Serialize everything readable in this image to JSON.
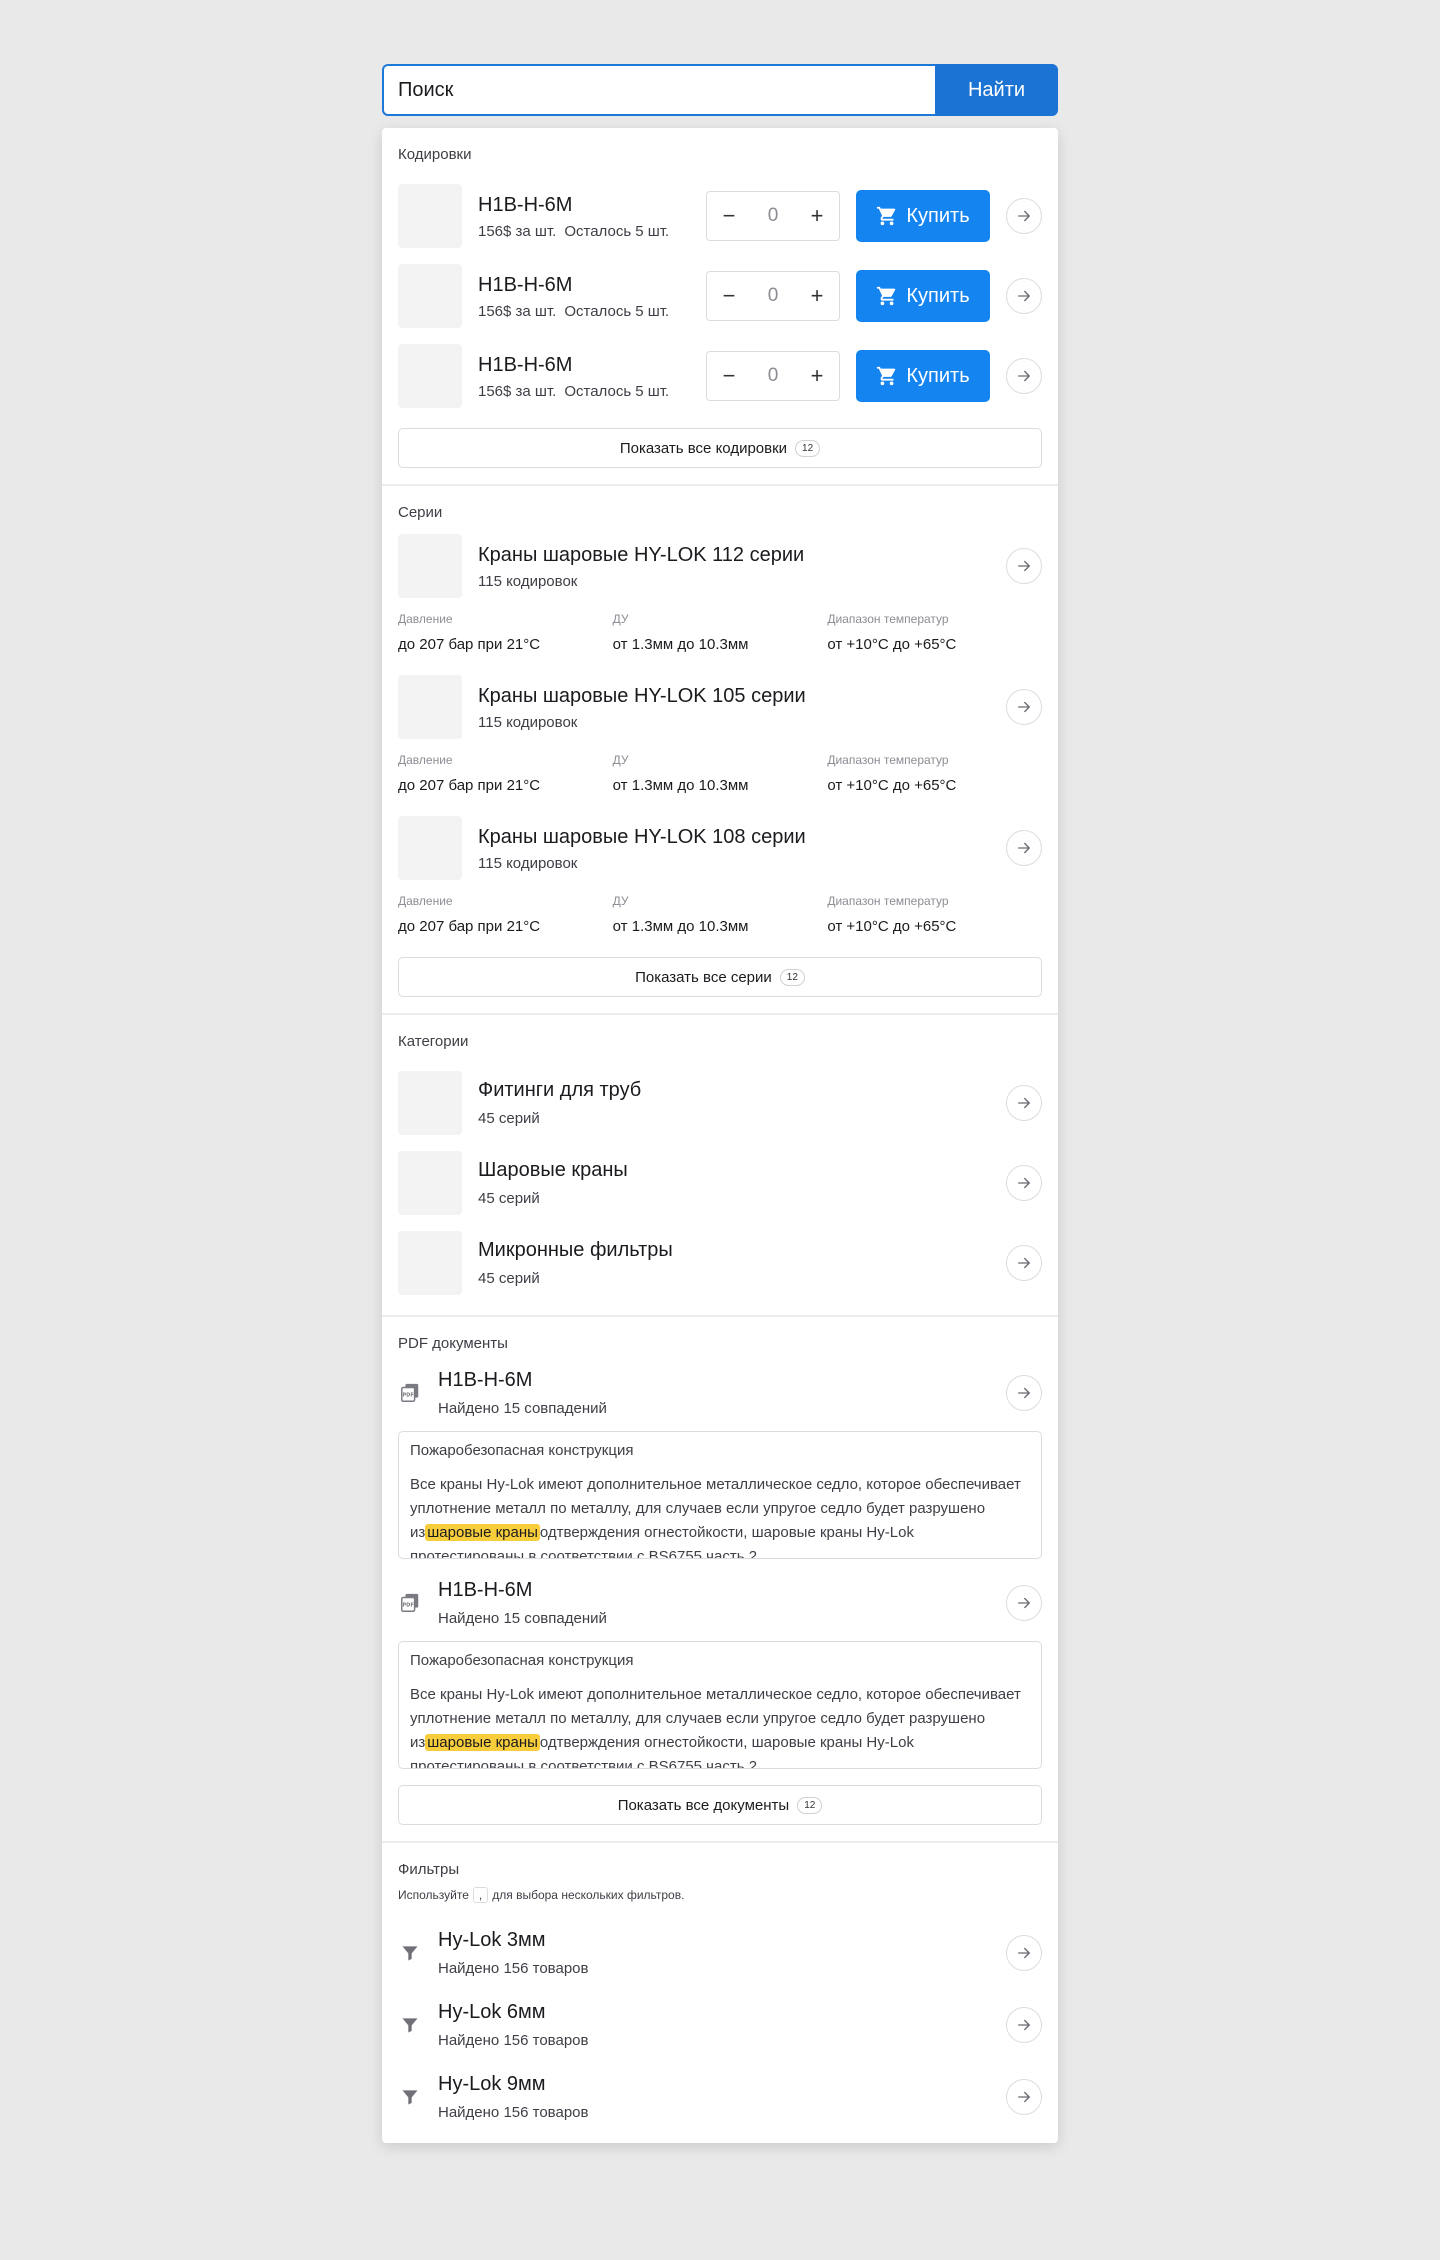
{
  "search": {
    "value": "Поиск",
    "button_label": "Найти"
  },
  "codings": {
    "title": "Кодировки",
    "items": [
      {
        "name": "H1B-H-6M",
        "price": "156$ за шт.",
        "stock": "Осталось 5 шт.",
        "qty": "0",
        "buy_label": "Купить"
      },
      {
        "name": "H1B-H-6M",
        "price": "156$ за шт.",
        "stock": "Осталось 5 шт.",
        "qty": "0",
        "buy_label": "Купить"
      },
      {
        "name": "H1B-H-6M",
        "price": "156$ за шт.",
        "stock": "Осталось 5 шт.",
        "qty": "0",
        "buy_label": "Купить"
      }
    ],
    "show_all_label": "Показать все кодировки",
    "show_all_count": "12"
  },
  "series": {
    "title": "Серии",
    "items": [
      {
        "name": "Краны шаровые HY-LOK 112 серии",
        "count": "115 кодировок",
        "specs": [
          {
            "label": "Давление",
            "value": "до 207 бар при 21°C"
          },
          {
            "label": "ДУ",
            "value": "от 1.3мм до 10.3мм"
          },
          {
            "label": "Диапазон температур",
            "value": "от +10°C до +65°C"
          }
        ]
      },
      {
        "name": "Краны шаровые HY-LOK 105 серии",
        "count": "115 кодировок",
        "specs": [
          {
            "label": "Давление",
            "value": "до 207 бар при 21°C"
          },
          {
            "label": "ДУ",
            "value": "от 1.3мм до 10.3мм"
          },
          {
            "label": "Диапазон температур",
            "value": "от +10°C до +65°C"
          }
        ]
      },
      {
        "name": "Краны шаровые HY-LOK 108 серии",
        "count": "115 кодировок",
        "specs": [
          {
            "label": "Давление",
            "value": "до 207 бар при 21°C"
          },
          {
            "label": "ДУ",
            "value": "от 1.3мм до 10.3мм"
          },
          {
            "label": "Диапазон температур",
            "value": "от +10°C до +65°C"
          }
        ]
      }
    ],
    "show_all_label": "Показать все серии",
    "show_all_count": "12"
  },
  "categories": {
    "title": "Категории",
    "items": [
      {
        "name": "Фитинги для труб",
        "count": "45 серий"
      },
      {
        "name": "Шаровые краны",
        "count": "45 серий"
      },
      {
        "name": "Микронные фильтры",
        "count": "45 серий"
      }
    ]
  },
  "documents": {
    "title": "PDF документы",
    "items": [
      {
        "name": "H1B-H-6M",
        "count": "Найдено 15 совпадений",
        "preview_title": "Пожаробезопасная конструкция",
        "text_before": "Все краны Hy-Lok имеют дополнительное металлическое седло, которое обеспечивает уплотнение металл по металлу, для случаев если упругое седло будет разрушено из",
        "highlight": "шаровые краны",
        "text_after": "одтверждения огнестойкости, шаровые краны Hy-Lok протестированы в соответствии с BS6755 часть 2."
      },
      {
        "name": "H1B-H-6M",
        "count": "Найдено 15 совпадений",
        "preview_title": "Пожаробезопасная конструкция",
        "text_before": "Все краны Hy-Lok имеют дополнительное металлическое седло, которое обеспечивает уплотнение металл по металлу, для случаев если упругое седло будет разрушено из",
        "highlight": "шаровые краны",
        "text_after": "одтверждения огнестойкости, шаровые краны Hy-Lok протестированы в соответствии с BS6755 часть 2."
      }
    ],
    "show_all_label": "Показать все документы",
    "show_all_count": "12"
  },
  "filters": {
    "title": "Фильтры",
    "hint_before": "Используйте",
    "hint_key": ",",
    "hint_after": "для выбора нескольких фильтров.",
    "items": [
      {
        "name": "Hy-Lok 3мм",
        "count": "Найдено 156 товаров"
      },
      {
        "name": "Hy-Lok 6мм",
        "count": "Найдено 156 товаров"
      },
      {
        "name": "Hy-Lok 9мм",
        "count": "Найдено 156 товаров"
      }
    ]
  },
  "colors": {
    "accent": "#1484f0",
    "search_button": "#1b73d3",
    "highlight": "#f7cd3b"
  },
  "icons": {
    "arrow": "arrow-right-icon",
    "cart": "cart-icon",
    "pdf": "pdf-icon",
    "filter": "funnel-icon"
  }
}
